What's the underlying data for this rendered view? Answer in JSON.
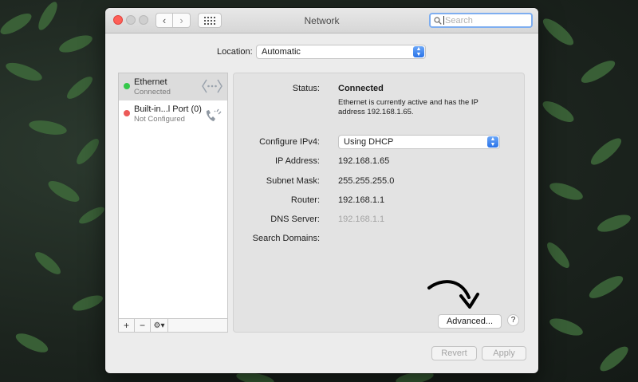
{
  "window": {
    "title": "Network"
  },
  "toolbar": {
    "search_placeholder": "Search"
  },
  "location": {
    "label": "Location:",
    "value": "Automatic"
  },
  "services": [
    {
      "name": "Ethernet",
      "status": "Connected",
      "status_color": "#34c84a",
      "icon": "ethernet-icon"
    },
    {
      "name": "Built-in...l Port (0)",
      "status": "Not Configured",
      "status_color": "#ec5a58",
      "icon": "phone-modem-icon"
    }
  ],
  "sidebar_controls": {
    "add": "+",
    "remove": "−",
    "action": "⚙︎▾"
  },
  "details": {
    "status_label": "Status:",
    "status_value": "Connected",
    "status_description": "Ethernet is currently active and has the IP address 192.168.1.65.",
    "configure_label": "Configure IPv4:",
    "configure_value": "Using DHCP",
    "ip_label": "IP Address:",
    "ip_value": "192.168.1.65",
    "subnet_label": "Subnet Mask:",
    "subnet_value": "255.255.255.0",
    "router_label": "Router:",
    "router_value": "192.168.1.1",
    "dns_label": "DNS Server:",
    "dns_value": "192.168.1.1",
    "search_domains_label": "Search Domains:"
  },
  "buttons": {
    "advanced": "Advanced...",
    "help": "?",
    "revert": "Revert",
    "apply": "Apply"
  },
  "colors": {
    "accent": "#2a73e8",
    "close": "#fe5f57",
    "panel": "#e3e3e3"
  }
}
